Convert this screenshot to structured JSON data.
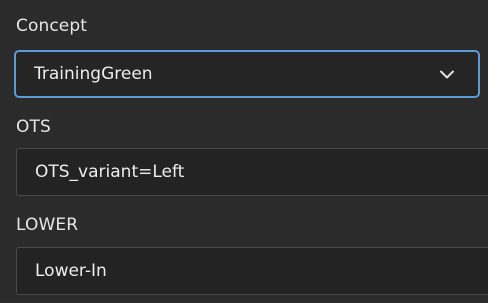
{
  "concept": {
    "label": "Concept",
    "selected_value": "TrainingGreen",
    "dropdown_icon": "chevron-down-icon"
  },
  "ots": {
    "label": "OTS",
    "value": "OTS_variant=Left"
  },
  "lower": {
    "label": "LOWER",
    "value": "Lower-In"
  },
  "colors": {
    "background": "#2b2b2b",
    "field_background": "#232323",
    "focus_border": "#5b9bd5"
  }
}
